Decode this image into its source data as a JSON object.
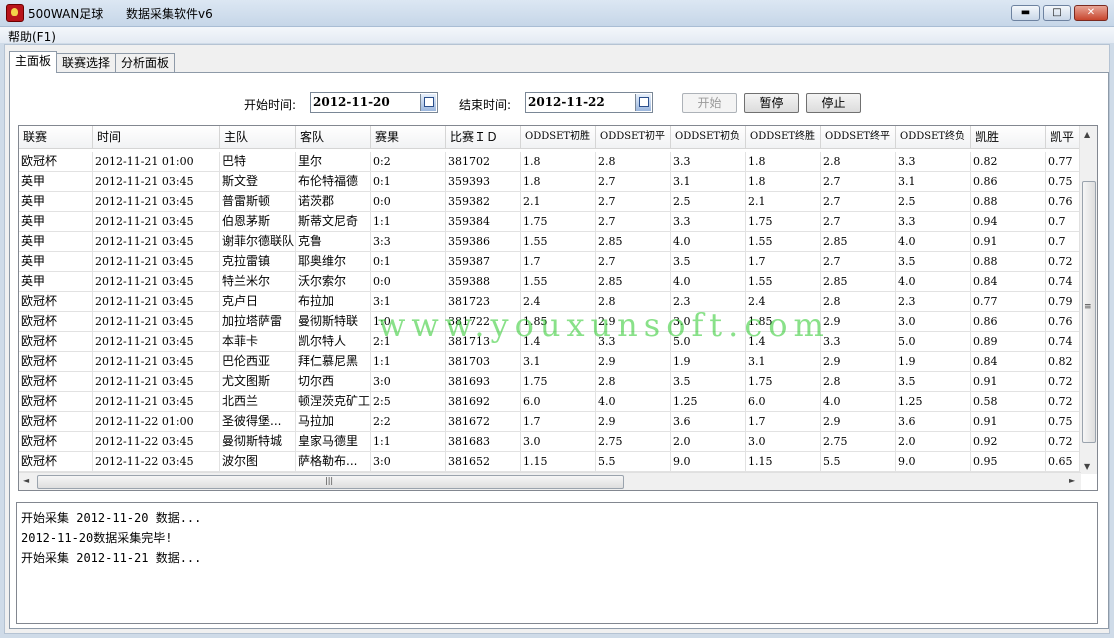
{
  "window": {
    "app_name": "500WAN足球",
    "subtitle": "数据采集软件v6",
    "minimize": "▬",
    "maximize": "□",
    "close": "✕"
  },
  "menu": {
    "help": "帮助(F1)"
  },
  "tabs": [
    "主面板",
    "联赛选择",
    "分析面板"
  ],
  "controls": {
    "start_label": "开始时间:",
    "start_value": "2012-11-20",
    "end_label": "结束时间:",
    "end_value": "2012-11-22",
    "btn_start": "开始",
    "btn_pause": "暂停",
    "btn_stop": "停止"
  },
  "table": {
    "headers": [
      "联赛",
      "时间",
      "主队",
      "客队",
      "赛果",
      "比赛ＩＤ",
      "ODDSET初胜",
      "ODDSET初平",
      "ODDSET初负",
      "ODDSET终胜",
      "ODDSET终平",
      "ODDSET终负",
      "凯胜",
      "凯平"
    ],
    "rows": [
      [
        "欧冠杯",
        "2012-11-21 01:00",
        "巴特",
        "里尔",
        "0:2",
        "381702",
        "1.8",
        "2.8",
        "3.3",
        "1.8",
        "2.8",
        "3.3",
        "0.82",
        "0.77"
      ],
      [
        "英甲",
        "2012-11-21 03:45",
        "斯文登",
        "布伦特福德",
        "0:1",
        "359393",
        "1.8",
        "2.7",
        "3.1",
        "1.8",
        "2.7",
        "3.1",
        "0.86",
        "0.75"
      ],
      [
        "英甲",
        "2012-11-21 03:45",
        "普雷斯顿",
        "诺茨郡",
        "0:0",
        "359382",
        "2.1",
        "2.7",
        "2.5",
        "2.1",
        "2.7",
        "2.5",
        "0.88",
        "0.76"
      ],
      [
        "英甲",
        "2012-11-21 03:45",
        "伯恩茅斯",
        "斯蒂文尼奇",
        "1:1",
        "359384",
        "1.75",
        "2.7",
        "3.3",
        "1.75",
        "2.7",
        "3.3",
        "0.94",
        "0.7"
      ],
      [
        "英甲",
        "2012-11-21 03:45",
        "谢菲尔德联队",
        "克鲁",
        "3:3",
        "359386",
        "1.55",
        "2.85",
        "4.0",
        "1.55",
        "2.85",
        "4.0",
        "0.91",
        "0.7"
      ],
      [
        "英甲",
        "2012-11-21 03:45",
        "克拉雷镇",
        "耶奥维尔",
        "0:1",
        "359387",
        "1.7",
        "2.7",
        "3.5",
        "1.7",
        "2.7",
        "3.5",
        "0.88",
        "0.72"
      ],
      [
        "英甲",
        "2012-11-21 03:45",
        "特兰米尔",
        "沃尔索尔",
        "0:0",
        "359388",
        "1.55",
        "2.85",
        "4.0",
        "1.55",
        "2.85",
        "4.0",
        "0.84",
        "0.74"
      ],
      [
        "欧冠杯",
        "2012-11-21 03:45",
        "克卢日",
        "布拉加",
        "3:1",
        "381723",
        "2.4",
        "2.8",
        "2.3",
        "2.4",
        "2.8",
        "2.3",
        "0.77",
        "0.79"
      ],
      [
        "欧冠杯",
        "2012-11-21 03:45",
        "加拉塔萨雷",
        "曼彻斯特联",
        "1:0",
        "381722",
        "1.85",
        "2.9",
        "3.0",
        "1.85",
        "2.9",
        "3.0",
        "0.86",
        "0.76"
      ],
      [
        "欧冠杯",
        "2012-11-21 03:45",
        "本菲卡",
        "凯尔特人",
        "2:1",
        "381713",
        "1.4",
        "3.3",
        "5.0",
        "1.4",
        "3.3",
        "5.0",
        "0.89",
        "0.74"
      ],
      [
        "欧冠杯",
        "2012-11-21 03:45",
        "巴伦西亚",
        "拜仁慕尼黑",
        "1:1",
        "381703",
        "3.1",
        "2.9",
        "1.9",
        "3.1",
        "2.9",
        "1.9",
        "0.84",
        "0.82"
      ],
      [
        "欧冠杯",
        "2012-11-21 03:45",
        "尤文图斯",
        "切尔西",
        "3:0",
        "381693",
        "1.75",
        "2.8",
        "3.5",
        "1.75",
        "2.8",
        "3.5",
        "0.91",
        "0.72"
      ],
      [
        "欧冠杯",
        "2012-11-21 03:45",
        "北西兰",
        "顿涅茨克矿工",
        "2:5",
        "381692",
        "6.0",
        "4.0",
        "1.25",
        "6.0",
        "4.0",
        "1.25",
        "0.58",
        "0.72"
      ],
      [
        "欧冠杯",
        "2012-11-22 01:00",
        "圣彼得堡...",
        "马拉加",
        "2:2",
        "381672",
        "1.7",
        "2.9",
        "3.6",
        "1.7",
        "2.9",
        "3.6",
        "0.91",
        "0.75"
      ],
      [
        "欧冠杯",
        "2012-11-22 03:45",
        "曼彻斯特城",
        "皇家马德里",
        "1:1",
        "381683",
        "3.0",
        "2.75",
        "2.0",
        "3.0",
        "2.75",
        "2.0",
        "0.92",
        "0.72"
      ],
      [
        "欧冠杯",
        "2012-11-22 03:45",
        "波尔图",
        "萨格勒布...",
        "3:0",
        "381652",
        "1.15",
        "5.5",
        "9.0",
        "1.15",
        "5.5",
        "9.0",
        "0.95",
        "0.65"
      ]
    ]
  },
  "scroll": {
    "up": "▲",
    "down": "▼",
    "left": "◄",
    "right": "►",
    "grip_v": "≡",
    "grip_h": "|||"
  },
  "watermark": "www.youxunsoft.com",
  "log": [
    "开始采集 2012-11-20 数据...",
    "2012-11-20数据采集完毕!",
    "开始采集 2012-11-21 数据..."
  ]
}
